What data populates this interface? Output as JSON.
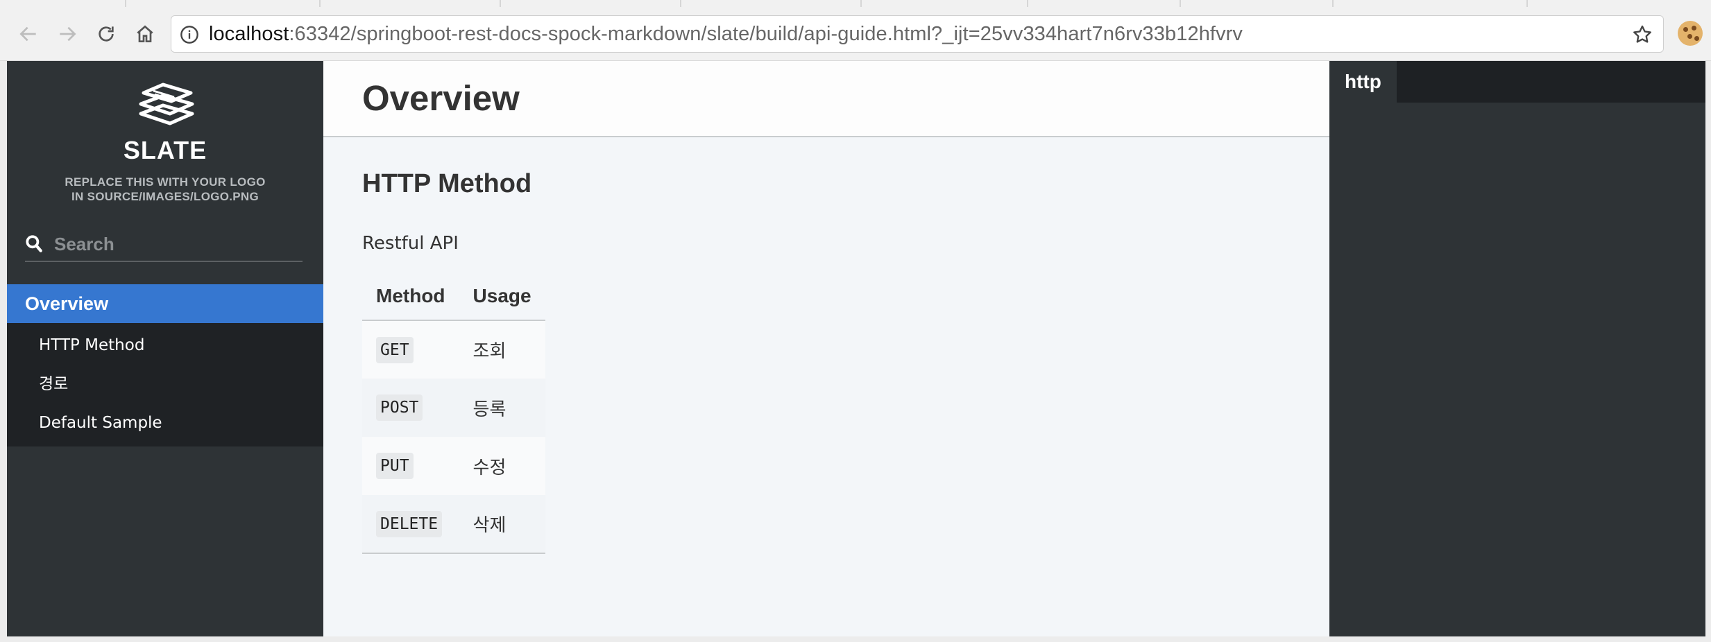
{
  "browser": {
    "url_host": "localhost",
    "url_rest": ":63342/springboot-rest-docs-spock-markdown/slate/build/api-guide.html?_ijt=25vv334hart7n6rv33b12hfvrv",
    "icons": [
      "back-arrow-icon",
      "forward-arrow-icon",
      "reload-icon",
      "home-icon",
      "info-icon",
      "star-icon",
      "cookie-icon"
    ]
  },
  "sidebar": {
    "logo_title": "SLATE",
    "logo_sub_line1": "REPLACE THIS WITH YOUR LOGO",
    "logo_sub_line2": "IN SOURCE/IMAGES/LOGO.PNG",
    "search_placeholder": "Search",
    "toc": {
      "active": "Overview",
      "items": [
        "HTTP Method",
        "경로",
        "Default Sample"
      ]
    }
  },
  "main": {
    "title": "Overview",
    "section_title": "HTTP Method",
    "paragraph": "Restful API",
    "table": {
      "headers": [
        "Method",
        "Usage"
      ],
      "rows": [
        [
          "GET",
          "조회"
        ],
        [
          "POST",
          "등록"
        ],
        [
          "PUT",
          "수정"
        ],
        [
          "DELETE",
          "삭제"
        ]
      ]
    }
  },
  "code_panel": {
    "lang_tab": "http"
  },
  "colors": {
    "sidebar_bg": "#2e3336",
    "toc_active_bg": "#3677d0",
    "toc_sub_bg": "#1f2225",
    "main_bg": "#f3f6f9",
    "code_bg": "#2e3336"
  }
}
